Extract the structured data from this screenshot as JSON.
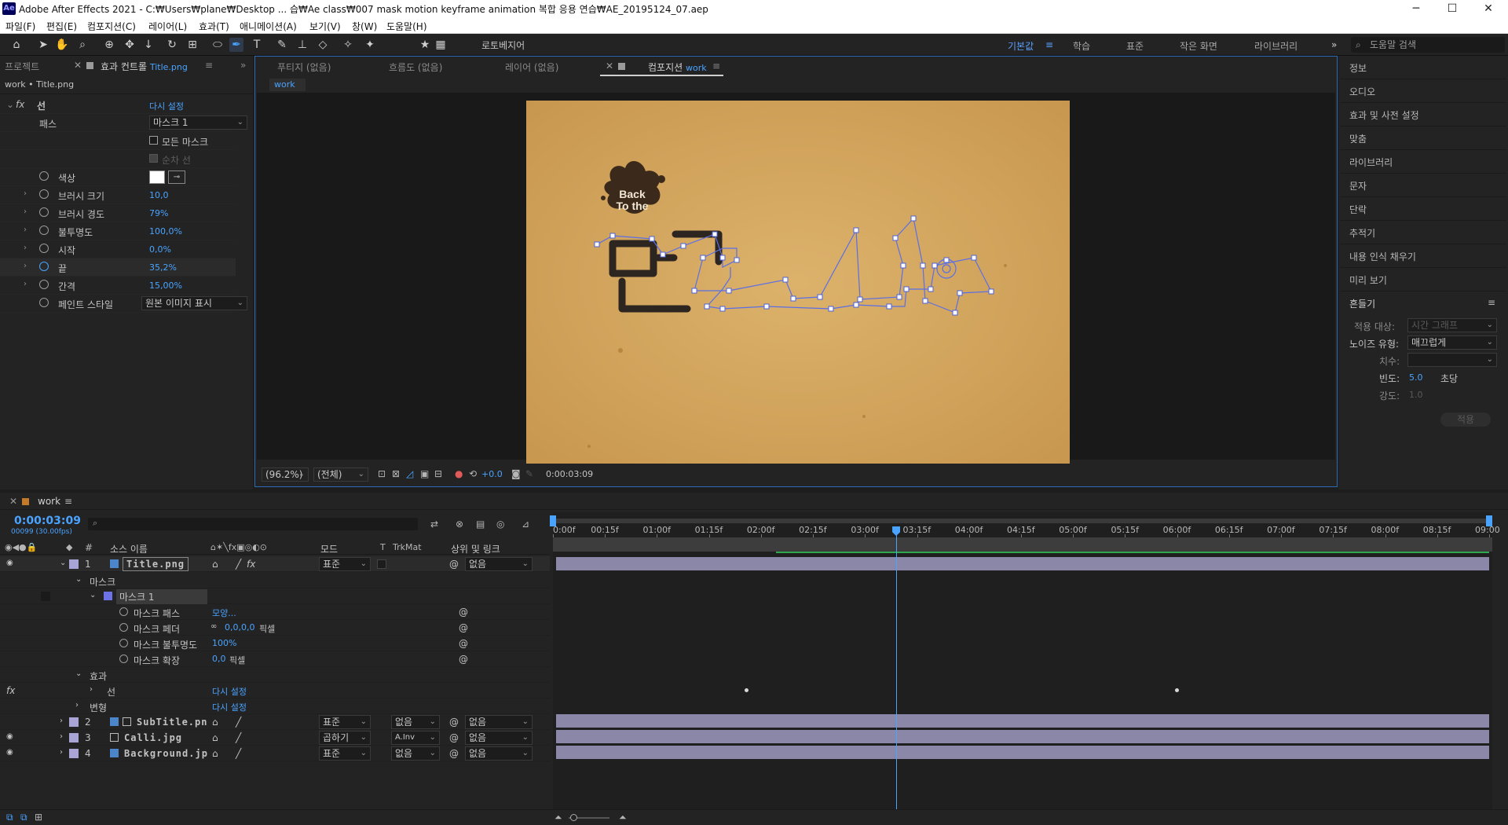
{
  "window": {
    "app_badge": "Ae",
    "title": "Adobe After Effects 2021 - C:₩Users₩plane₩Desktop ... 습₩Ae class₩007 mask motion keyframe animation 복합 응용 연습₩AE_20195124_07.aep",
    "controls": {
      "minimize": "─",
      "maximize": "☐",
      "close": "✕"
    }
  },
  "menu": [
    "파일(F)",
    "편집(E)",
    "컴포지션(C)",
    "레이어(L)",
    "효과(T)",
    "애니메이션(A)",
    "보기(V)",
    "창(W)",
    "도움말(H)"
  ],
  "toolbar": {
    "roto_label": "로토베지어",
    "workspaces": [
      "기본값",
      "학습",
      "표준",
      "작은 화면",
      "라이브러리"
    ],
    "active_workspace_menu": "≡",
    "overflow": "»",
    "search_placeholder": "도움말 검색"
  },
  "left_panel": {
    "tab_project": "프로젝트",
    "tab_effects": "효과 컨트롤",
    "tab_effects_sub": "Title.png",
    "breadcrumb": "work • Title.png",
    "effect_name": "선",
    "reset": "다시 설정",
    "rows": [
      {
        "label": "패스",
        "value": "마스크 1",
        "type": "dropdown"
      },
      {
        "label": "모든 마스크",
        "type": "checkbox"
      },
      {
        "label": "순차 선",
        "type": "checkbox-disabled"
      },
      {
        "label": "색상",
        "type": "color",
        "color": "#ffffff"
      },
      {
        "label": "브러시 크기",
        "value": "10,0"
      },
      {
        "label": "브러시 경도",
        "value": "79%"
      },
      {
        "label": "불투명도",
        "value": "100,0%"
      },
      {
        "label": "시작",
        "value": "0,0%"
      },
      {
        "label": "끝",
        "value": "35,2%"
      },
      {
        "label": "간격",
        "value": "15,00%"
      },
      {
        "label": "페인트 스타일",
        "value": "원본 이미지 표시",
        "type": "dropdown"
      }
    ]
  },
  "comp_panel": {
    "tabs": [
      "푸티지 (없음)",
      "흐름도 (없음)",
      "레이어 (없음)"
    ],
    "active_tab": "컴포지션",
    "active_tab_sub": "work",
    "subtab": "work",
    "canvas_text_1": "Back",
    "canvas_text_2": "To the",
    "zoom": "(96.2%)",
    "resolution": "(전체)",
    "exposure": "+0.0",
    "timecode": "0:00:03:09"
  },
  "right_panel": {
    "items": [
      "정보",
      "오디오",
      "효과 및 사전 설정",
      "맞춤",
      "라이브러리",
      "문자",
      "단락",
      "추적기",
      "내용 인식 채우기",
      "미리 보기"
    ],
    "wiggler": {
      "title": "흔들기",
      "apply_to_label": "적용 대상:",
      "apply_to_value": "시간 그래프",
      "noise_label": "노이즈 유형:",
      "noise_value": "매끄럽게",
      "dimension_label": "치수:",
      "freq_label": "빈도:",
      "freq_value": "5.0",
      "freq_unit": "초당",
      "strength_label": "강도:",
      "strength_value": "1.0",
      "apply_button": "적용"
    }
  },
  "timeline": {
    "comp_tab": "work",
    "timecode": "0:00:03:09",
    "frame_info": "00099 (30.00fps)",
    "col_num": "#",
    "col_source": "소스 이름",
    "col_mode": "모드",
    "col_t": "T",
    "col_trkmat": "TrkMat",
    "col_parent": "상위 및 링크",
    "ruler": [
      "0:00f",
      "00:15f",
      "01:00f",
      "01:15f",
      "02:00f",
      "02:15f",
      "03:00f",
      "03:15f",
      "04:00f",
      "04:15f",
      "05:00f",
      "05:15f",
      "06:00f",
      "06:15f",
      "07:00f",
      "07:15f",
      "08:00f",
      "08:15f",
      "09:00"
    ],
    "layers": [
      {
        "num": "1",
        "name": "Title.png",
        "mode": "표준",
        "trkmat": "",
        "parent": "없음"
      },
      {
        "num": "2",
        "name": "SubTitle.pn",
        "mode": "표준",
        "trkmat": "없음",
        "parent": "없음"
      },
      {
        "num": "3",
        "name": "Calli.jpg",
        "mode": "곱하기",
        "trkmat": "A.Inv",
        "parent": "없음"
      },
      {
        "num": "4",
        "name": "Background.jp",
        "mode": "표준",
        "trkmat": "없음",
        "parent": "없음"
      }
    ],
    "mask_group": "마스크",
    "mask_name": "마스크 1",
    "mask_props": [
      {
        "label": "마스크 패스",
        "value": "모양...",
        "unit": ""
      },
      {
        "label": "마스크 페더",
        "value": "0,0,0,0",
        "unit": "픽셀"
      },
      {
        "label": "마스크 불투명도",
        "value": "100%",
        "unit": ""
      },
      {
        "label": "마스크 확장",
        "value": "0,0",
        "unit": "픽셀"
      }
    ],
    "effects_group": "효과",
    "effect_item": "선",
    "effect_reset": "다시 설정",
    "transform_group": "변형",
    "transform_reset": "다시 설정",
    "playhead_time": 3.3
  }
}
